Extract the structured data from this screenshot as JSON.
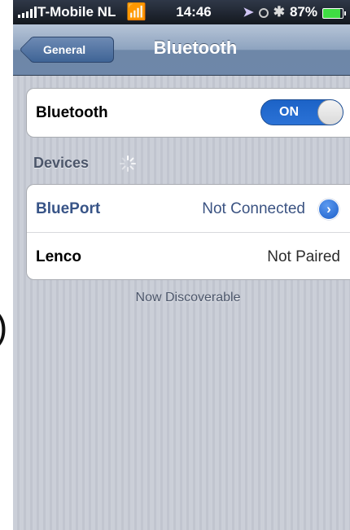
{
  "stray_glyph": ")",
  "status_bar": {
    "carrier": "T-Mobile NL",
    "time": "14:46",
    "battery_percent": "87%",
    "battery_level": 0.87
  },
  "nav": {
    "back_label": "General",
    "title": "Bluetooth"
  },
  "bluetooth": {
    "label": "Bluetooth",
    "toggle_label": "ON",
    "accent_color": "#2b72d6"
  },
  "devices": {
    "header": "Devices",
    "items": [
      {
        "name": "BluePort",
        "status": "Not Connected"
      },
      {
        "name": "Lenco",
        "status": "Not Paired"
      }
    ]
  },
  "footer": {
    "text": "Now Discoverable"
  },
  "icons": {
    "wifi": "wifi-icon",
    "location": "location-icon",
    "orientation_lock": "lock-icon",
    "bluetooth": "bluetooth-icon",
    "battery": "battery-icon",
    "spinner": "spinner-icon",
    "disclosure": "disclosure-icon"
  }
}
